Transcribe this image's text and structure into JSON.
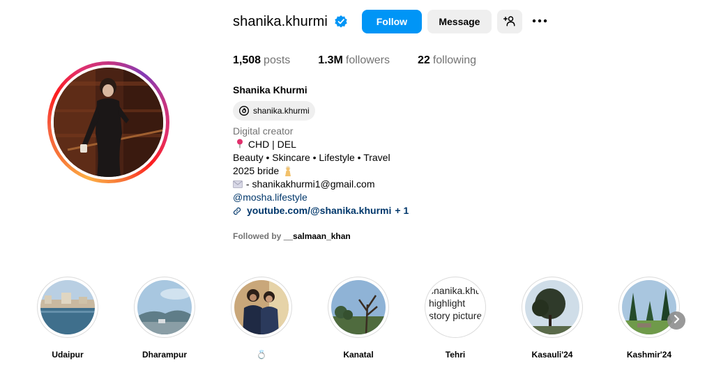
{
  "profile": {
    "username": "shanika.khurmi",
    "verified": true,
    "full_name": "Shanika Khurmi",
    "threads_handle": "shanika.khurmi"
  },
  "actions": {
    "follow_label": "Follow",
    "message_label": "Message"
  },
  "stats": {
    "posts_count": "1,508",
    "posts_label": "posts",
    "followers_count": "1.3M",
    "followers_label": "followers",
    "following_count": "22",
    "following_label": "following"
  },
  "bio": {
    "category": "Digital creator",
    "line1": "CHD | DEL",
    "line2": "Beauty • Skincare • Lifestyle • Travel",
    "line3": "2025 bride",
    "line4": "- shanikakhurmi1@gmail.com",
    "mention": "@mosha.lifestyle",
    "link": "youtube.com/@shanika.khurmi",
    "link_extra": "+ 1"
  },
  "followed_by": {
    "prefix": "Followed by",
    "name": "__salmaan_khan"
  },
  "highlights": [
    {
      "label": "Udaipur"
    },
    {
      "label": "Dharampur"
    },
    {
      "label": "💍"
    },
    {
      "label": "Kanatal"
    },
    {
      "label": "Tehri",
      "broken_alt": "shanika.khurmi's highlight story picture"
    },
    {
      "label": "Kasauli'24"
    },
    {
      "label": "Kashmir'24"
    }
  ],
  "colors": {
    "accent": "#0095f6",
    "link": "#00376b",
    "muted": "#737373",
    "button_bg": "#efefef"
  }
}
